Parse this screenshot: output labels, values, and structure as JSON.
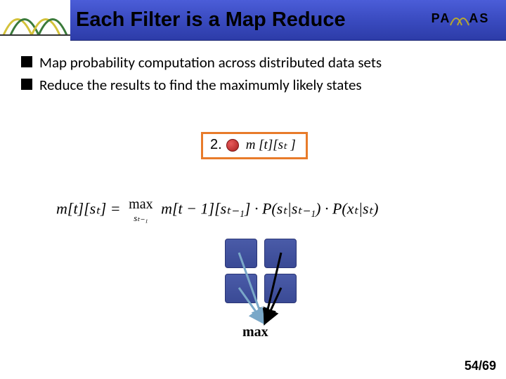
{
  "header": {
    "title": "Each Filter is a Map Reduce",
    "logo_right_text": "PA   AS"
  },
  "bullets": [
    "Map probability computation across distributed data sets",
    "Reduce the results to find the maximumly likely states"
  ],
  "box2": {
    "number": "2.",
    "icon": "s-node-icon",
    "formula": "m [t][sₜ ]"
  },
  "formula": {
    "lhs": "m[t][sₜ] =",
    "max_op": "max",
    "max_sub": "sₜ₋₁",
    "rhs": "m[t − 1][sₜ₋₁] · P(sₜ|sₜ₋₁) · P(xₜ|sₜ)"
  },
  "diagram": {
    "label": "max"
  },
  "page": {
    "current": "54",
    "total": "69"
  }
}
